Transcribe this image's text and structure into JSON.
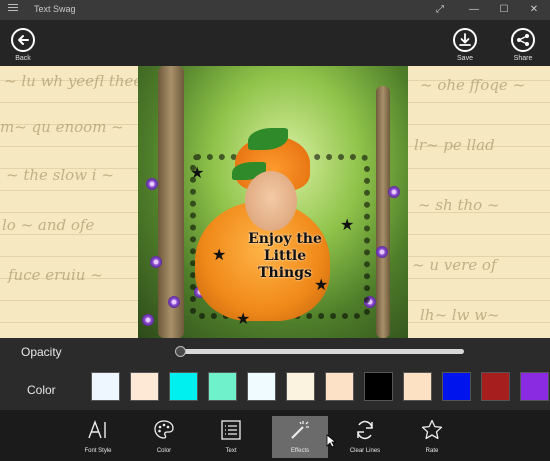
{
  "window": {
    "title": "Text Swag",
    "controls": [
      "⤢",
      "—",
      "☐",
      "✕"
    ]
  },
  "appbar": {
    "back_label": "Back",
    "save_label": "Save",
    "share_label": "Share"
  },
  "canvas": {
    "overlay_text_lines": [
      "Enjoy the",
      "Little",
      "Things"
    ]
  },
  "controls": {
    "opacity_label": "Opacity",
    "opacity_value": 0.0,
    "color_label": "Color",
    "swatches": [
      "#eef6ff",
      "#fde9d6",
      "#00f0f0",
      "#6ff2cc",
      "#effbff",
      "#fbf2df",
      "#fde1c6",
      "#000000",
      "#fde1c3",
      "#0014ee",
      "#a71e1e",
      "#8a2be2"
    ]
  },
  "toolbar": {
    "items": [
      {
        "label": "Font Style",
        "icon": "font-style-icon"
      },
      {
        "label": "Color",
        "icon": "palette-icon"
      },
      {
        "label": "Text",
        "icon": "text-list-icon"
      },
      {
        "label": "Effects",
        "icon": "magic-wand-icon",
        "active": true
      },
      {
        "label": "Clear Lines",
        "icon": "refresh-icon"
      },
      {
        "label": "Rate",
        "icon": "star-icon"
      }
    ]
  },
  "colors": {
    "accent": "#6b6b6b",
    "background": "#1f1f1f",
    "paper": "#f6e8c0"
  }
}
